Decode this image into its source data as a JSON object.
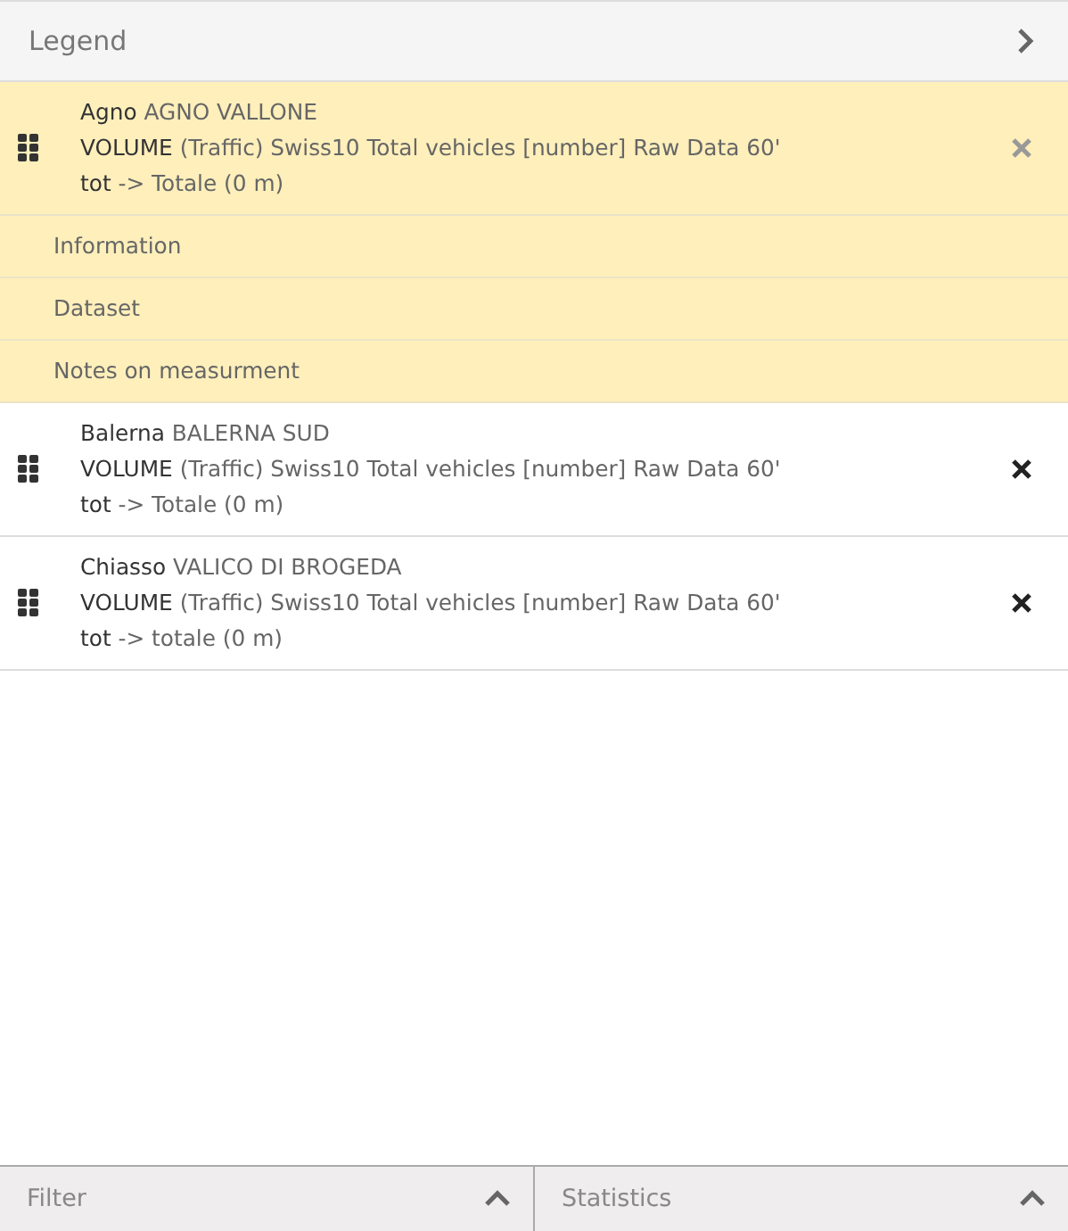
{
  "header": {
    "title": "Legend"
  },
  "entries": [
    {
      "selected": true,
      "station": "Agno",
      "station_name": "AGNO VALLONE",
      "measure": "VOLUME",
      "description": "(Traffic) Swiss10 Total vehicles [number] Raw Data 60'",
      "sensor": "tot",
      "sensor_detail": "-> Totale (0 m)",
      "submenu": [
        "Information",
        "Dataset",
        "Notes on measurment"
      ]
    },
    {
      "selected": false,
      "station": "Balerna",
      "station_name": "BALERNA SUD",
      "measure": "VOLUME",
      "description": "(Traffic) Swiss10 Total vehicles [number] Raw Data 60'",
      "sensor": "tot",
      "sensor_detail": "-> Totale (0 m)"
    },
    {
      "selected": false,
      "station": "Chiasso",
      "station_name": "VALICO DI BROGEDA",
      "measure": "VOLUME",
      "description": "(Traffic) Swiss10 Total vehicles [number] Raw Data 60'",
      "sensor": "tot",
      "sensor_detail": "-> totale (0 m)"
    }
  ],
  "footer_panels": [
    {
      "label": "Filter"
    },
    {
      "label": "Statistics"
    }
  ]
}
